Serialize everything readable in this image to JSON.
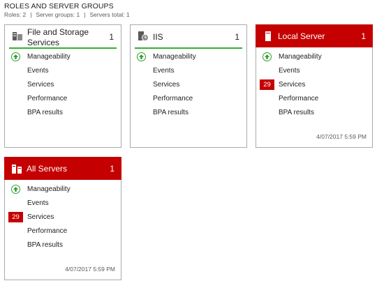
{
  "section": {
    "title": "ROLES AND SERVER GROUPS",
    "roles": "Roles: 2",
    "server_groups": "Server groups: 1",
    "servers_total": "Servers total: 1",
    "separator": "|"
  },
  "colors": {
    "accent_red": "#c40000",
    "status_green": "#2fb32f"
  },
  "tiles": [
    {
      "title": "File and Storage Services",
      "count": "1",
      "icon": "file-storage-icon",
      "items": [
        "Manageability",
        "Events",
        "Services",
        "Performance",
        "BPA results"
      ]
    },
    {
      "title": "IIS",
      "count": "1",
      "icon": "iis-icon",
      "items": [
        "Manageability",
        "Events",
        "Services",
        "Performance",
        "BPA results"
      ]
    },
    {
      "title": "Local Server",
      "count": "1",
      "icon": "server-icon",
      "items": [
        "Manageability",
        "Events",
        "Services",
        "Performance",
        "BPA results"
      ],
      "services_badge": "29",
      "timestamp": "4/07/2017 5:59 PM"
    },
    {
      "title": "All Servers",
      "count": "1",
      "icon": "servers-icon",
      "items": [
        "Manageability",
        "Events",
        "Services",
        "Performance",
        "BPA results"
      ],
      "services_badge": "29",
      "timestamp": "4/07/2017 5:59 PM"
    }
  ]
}
